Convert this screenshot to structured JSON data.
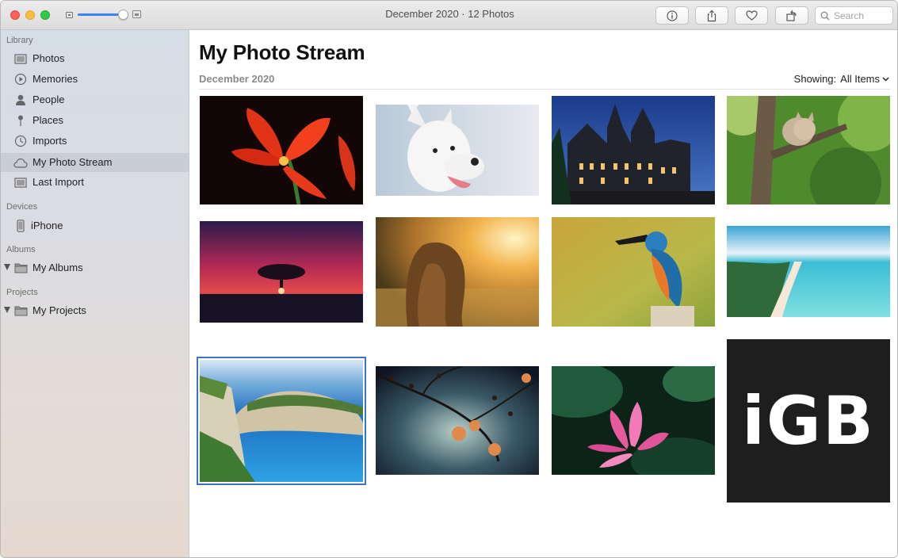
{
  "window": {
    "title": "December 2020 · 12 Photos"
  },
  "toolbar": {
    "search_placeholder": "Search",
    "buttons": [
      "info",
      "share",
      "favorite",
      "rotate"
    ]
  },
  "sidebar": {
    "sections": [
      {
        "label": "Library"
      },
      {
        "label": "Devices"
      },
      {
        "label": "Albums"
      },
      {
        "label": "Projects"
      }
    ],
    "library_items": [
      {
        "label": "Photos",
        "icon": "photos-icon"
      },
      {
        "label": "Memories",
        "icon": "memories-icon"
      },
      {
        "label": "People",
        "icon": "people-icon"
      },
      {
        "label": "Places",
        "icon": "places-pin-icon"
      },
      {
        "label": "Imports",
        "icon": "imports-clock-icon"
      },
      {
        "label": "My Photo Stream",
        "icon": "cloud-icon",
        "selected": true
      },
      {
        "label": "Last Import",
        "icon": "last-import-icon"
      }
    ],
    "device_items": [
      {
        "label": "iPhone",
        "icon": "iphone-icon"
      }
    ],
    "album_items": [
      {
        "label": "My Albums",
        "icon": "folder-icon"
      }
    ],
    "project_items": [
      {
        "label": "My Projects",
        "icon": "folder-icon"
      }
    ]
  },
  "main": {
    "title": "My Photo Stream",
    "subtitle": "December 2020",
    "showing_label": "Showing:",
    "showing_value": "All Items",
    "logo_text": "iGB",
    "photos": [
      {
        "subject": "red flower"
      },
      {
        "subject": "white dog"
      },
      {
        "subject": "town hall at night"
      },
      {
        "subject": "kitten in tree"
      },
      {
        "subject": "tree at sunset"
      },
      {
        "subject": "girl in meadow"
      },
      {
        "subject": "kingfisher"
      },
      {
        "subject": "tropical island"
      },
      {
        "subject": "cove beach",
        "selected": true
      },
      {
        "subject": "blossom branch"
      },
      {
        "subject": "lotus flower"
      },
      {
        "subject": "iGB logo"
      }
    ]
  },
  "colors": {
    "accent": "#3b82f6",
    "selection_outline": "#3b73c6",
    "sidebar_selected": "#c8cdd6"
  }
}
